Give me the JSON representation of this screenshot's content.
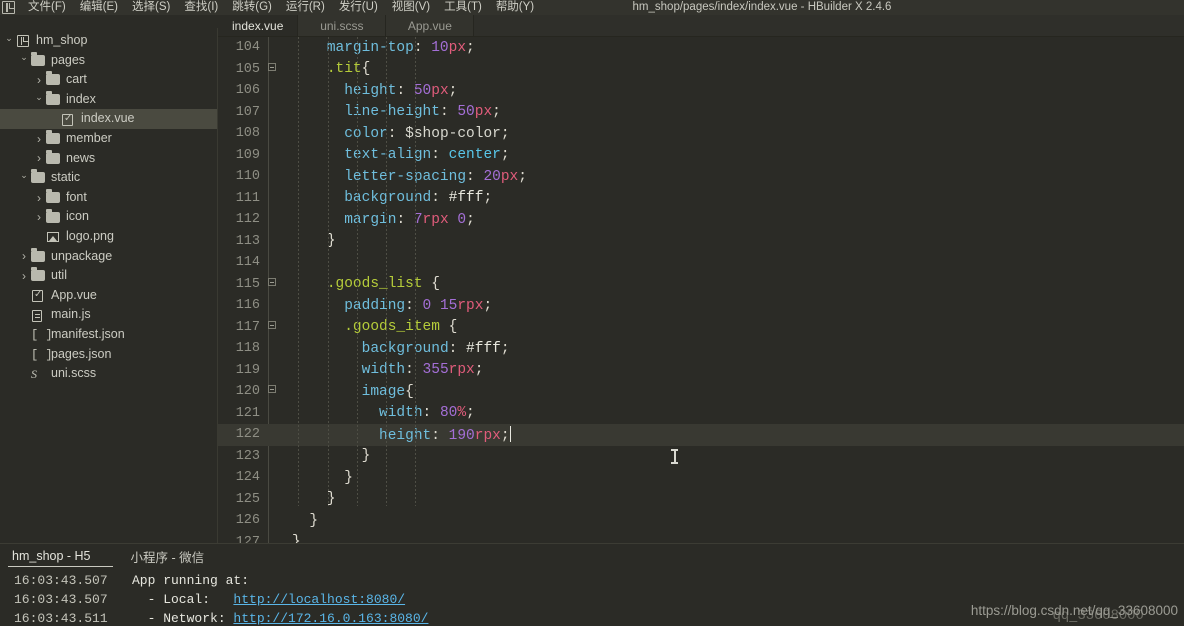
{
  "window": {
    "title": "hm_shop/pages/index/index.vue - HBuilder X 2.4.6",
    "logo_icon": "hbuilder-logo-icon"
  },
  "menubar": {
    "items": [
      {
        "label": "文件(F)",
        "name": "menu-file"
      },
      {
        "label": "编辑(E)",
        "name": "menu-edit"
      },
      {
        "label": "选择(S)",
        "name": "menu-select"
      },
      {
        "label": "查找(I)",
        "name": "menu-find"
      },
      {
        "label": "跳转(G)",
        "name": "menu-goto"
      },
      {
        "label": "运行(R)",
        "name": "menu-run"
      },
      {
        "label": "发行(U)",
        "name": "menu-publish"
      },
      {
        "label": "视图(V)",
        "name": "menu-view"
      },
      {
        "label": "工具(T)",
        "name": "menu-tools"
      },
      {
        "label": "帮助(Y)",
        "name": "menu-help"
      }
    ]
  },
  "tabs": [
    {
      "label": "index.vue",
      "active": true
    },
    {
      "label": "uni.scss",
      "active": false
    },
    {
      "label": "App.vue",
      "active": false
    }
  ],
  "sidebar": {
    "items": [
      {
        "label": "hm_shop",
        "depth": 0,
        "arrow": "down",
        "icon": "project-icon",
        "selected": false
      },
      {
        "label": "pages",
        "depth": 1,
        "arrow": "down",
        "icon": "folder-icon",
        "selected": false
      },
      {
        "label": "cart",
        "depth": 2,
        "arrow": "right",
        "icon": "folder-icon",
        "selected": false
      },
      {
        "label": "index",
        "depth": 2,
        "arrow": "down",
        "icon": "folder-icon",
        "selected": false
      },
      {
        "label": "index.vue",
        "depth": 3,
        "arrow": "none",
        "icon": "vue-file-icon",
        "selected": true
      },
      {
        "label": "member",
        "depth": 2,
        "arrow": "right",
        "icon": "folder-icon",
        "selected": false
      },
      {
        "label": "news",
        "depth": 2,
        "arrow": "right",
        "icon": "folder-icon",
        "selected": false
      },
      {
        "label": "static",
        "depth": 1,
        "arrow": "down",
        "icon": "folder-icon",
        "selected": false
      },
      {
        "label": "font",
        "depth": 2,
        "arrow": "right",
        "icon": "folder-icon",
        "selected": false
      },
      {
        "label": "icon",
        "depth": 2,
        "arrow": "right",
        "icon": "folder-icon",
        "selected": false
      },
      {
        "label": "logo.png",
        "depth": 2,
        "arrow": "none",
        "icon": "image-file-icon",
        "selected": false
      },
      {
        "label": "unpackage",
        "depth": 1,
        "arrow": "right",
        "icon": "folder-icon",
        "selected": false
      },
      {
        "label": "util",
        "depth": 1,
        "arrow": "right",
        "icon": "folder-icon",
        "selected": false
      },
      {
        "label": "App.vue",
        "depth": 1,
        "arrow": "none",
        "icon": "vue-file-icon",
        "selected": false
      },
      {
        "label": "main.js",
        "depth": 1,
        "arrow": "none",
        "icon": "js-file-icon",
        "selected": false
      },
      {
        "label": "manifest.json",
        "depth": 1,
        "arrow": "none",
        "icon": "json-file-icon",
        "selected": false
      },
      {
        "label": "pages.json",
        "depth": 1,
        "arrow": "none",
        "icon": "json-file-icon",
        "selected": false
      },
      {
        "label": "uni.scss",
        "depth": 1,
        "arrow": "none",
        "icon": "scss-file-icon",
        "selected": false
      }
    ]
  },
  "editor": {
    "first_line": 104,
    "current_line": 122,
    "lines": [
      {
        "n": 104,
        "fold": false,
        "tokens": [
          {
            "t": "\t\t",
            "c": "punc"
          },
          {
            "t": "margin-top",
            "c": "prop"
          },
          {
            "t": ": ",
            "c": "punc"
          },
          {
            "t": "10",
            "c": "num"
          },
          {
            "t": "px",
            "c": "unit"
          },
          {
            "t": ";",
            "c": "punc"
          }
        ]
      },
      {
        "n": 105,
        "fold": true,
        "tokens": [
          {
            "t": "\t\t",
            "c": "punc"
          },
          {
            "t": ".tit",
            "c": "sel"
          },
          {
            "t": "{",
            "c": "punc"
          }
        ]
      },
      {
        "n": 106,
        "fold": false,
        "tokens": [
          {
            "t": "\t\t\t",
            "c": "punc"
          },
          {
            "t": "height",
            "c": "prop"
          },
          {
            "t": ": ",
            "c": "punc"
          },
          {
            "t": "50",
            "c": "num"
          },
          {
            "t": "px",
            "c": "unit"
          },
          {
            "t": ";",
            "c": "punc"
          }
        ]
      },
      {
        "n": 107,
        "fold": false,
        "tokens": [
          {
            "t": "\t\t\t",
            "c": "punc"
          },
          {
            "t": "line-height",
            "c": "prop"
          },
          {
            "t": ": ",
            "c": "punc"
          },
          {
            "t": "50",
            "c": "num"
          },
          {
            "t": "px",
            "c": "unit"
          },
          {
            "t": ";",
            "c": "punc"
          }
        ]
      },
      {
        "n": 108,
        "fold": false,
        "tokens": [
          {
            "t": "\t\t\t",
            "c": "punc"
          },
          {
            "t": "color",
            "c": "prop"
          },
          {
            "t": ": ",
            "c": "punc"
          },
          {
            "t": "$shop-color",
            "c": "var"
          },
          {
            "t": ";",
            "c": "punc"
          }
        ]
      },
      {
        "n": 109,
        "fold": false,
        "tokens": [
          {
            "t": "\t\t\t",
            "c": "punc"
          },
          {
            "t": "text-align",
            "c": "prop"
          },
          {
            "t": ": ",
            "c": "punc"
          },
          {
            "t": "center",
            "c": "val"
          },
          {
            "t": ";",
            "c": "punc"
          }
        ]
      },
      {
        "n": 110,
        "fold": false,
        "tokens": [
          {
            "t": "\t\t\t",
            "c": "punc"
          },
          {
            "t": "letter-spacing",
            "c": "prop"
          },
          {
            "t": ": ",
            "c": "punc"
          },
          {
            "t": "20",
            "c": "num"
          },
          {
            "t": "px",
            "c": "unit"
          },
          {
            "t": ";",
            "c": "punc"
          }
        ]
      },
      {
        "n": 111,
        "fold": false,
        "tokens": [
          {
            "t": "\t\t\t",
            "c": "punc"
          },
          {
            "t": "background",
            "c": "prop"
          },
          {
            "t": ": ",
            "c": "punc"
          },
          {
            "t": "#fff",
            "c": "hex"
          },
          {
            "t": ";",
            "c": "punc"
          }
        ]
      },
      {
        "n": 112,
        "fold": false,
        "tokens": [
          {
            "t": "\t\t\t",
            "c": "punc"
          },
          {
            "t": "margin",
            "c": "prop"
          },
          {
            "t": ": ",
            "c": "punc"
          },
          {
            "t": "7",
            "c": "num"
          },
          {
            "t": "rpx",
            "c": "unit"
          },
          {
            "t": " ",
            "c": "punc"
          },
          {
            "t": "0",
            "c": "num"
          },
          {
            "t": ";",
            "c": "punc"
          }
        ]
      },
      {
        "n": 113,
        "fold": false,
        "tokens": [
          {
            "t": "\t\t",
            "c": "punc"
          },
          {
            "t": "}",
            "c": "punc"
          }
        ]
      },
      {
        "n": 114,
        "fold": false,
        "tokens": []
      },
      {
        "n": 115,
        "fold": true,
        "tokens": [
          {
            "t": "\t\t",
            "c": "punc"
          },
          {
            "t": ".goods_list",
            "c": "sel"
          },
          {
            "t": " {",
            "c": "punc"
          }
        ]
      },
      {
        "n": 116,
        "fold": false,
        "tokens": [
          {
            "t": "\t\t\t",
            "c": "punc"
          },
          {
            "t": "padding",
            "c": "prop"
          },
          {
            "t": ": ",
            "c": "punc"
          },
          {
            "t": "0",
            "c": "num"
          },
          {
            "t": " ",
            "c": "punc"
          },
          {
            "t": "15",
            "c": "num"
          },
          {
            "t": "rpx",
            "c": "unit"
          },
          {
            "t": ";",
            "c": "punc"
          }
        ]
      },
      {
        "n": 117,
        "fold": true,
        "tokens": [
          {
            "t": "\t\t\t",
            "c": "punc"
          },
          {
            "t": ".goods_item",
            "c": "sel"
          },
          {
            "t": " {",
            "c": "punc"
          }
        ]
      },
      {
        "n": 118,
        "fold": false,
        "tokens": [
          {
            "t": "\t\t\t\t",
            "c": "punc"
          },
          {
            "t": "background",
            "c": "prop"
          },
          {
            "t": ": ",
            "c": "punc"
          },
          {
            "t": "#fff",
            "c": "hex"
          },
          {
            "t": ";",
            "c": "punc"
          }
        ]
      },
      {
        "n": 119,
        "fold": false,
        "tokens": [
          {
            "t": "\t\t\t\t",
            "c": "punc"
          },
          {
            "t": "width",
            "c": "prop"
          },
          {
            "t": ": ",
            "c": "punc"
          },
          {
            "t": "355",
            "c": "num"
          },
          {
            "t": "rpx",
            "c": "unit"
          },
          {
            "t": ";",
            "c": "punc"
          }
        ]
      },
      {
        "n": 120,
        "fold": true,
        "tokens": [
          {
            "t": "\t\t\t\t",
            "c": "punc"
          },
          {
            "t": "image",
            "c": "prop"
          },
          {
            "t": "{",
            "c": "punc"
          }
        ]
      },
      {
        "n": 121,
        "fold": false,
        "tokens": [
          {
            "t": "\t\t\t\t\t",
            "c": "punc"
          },
          {
            "t": "width",
            "c": "prop"
          },
          {
            "t": ": ",
            "c": "punc"
          },
          {
            "t": "80",
            "c": "num"
          },
          {
            "t": "%",
            "c": "unit"
          },
          {
            "t": ";",
            "c": "punc"
          }
        ]
      },
      {
        "n": 122,
        "fold": false,
        "tokens": [
          {
            "t": "\t\t\t\t\t",
            "c": "punc"
          },
          {
            "t": "height",
            "c": "prop"
          },
          {
            "t": ": ",
            "c": "punc"
          },
          {
            "t": "190",
            "c": "num"
          },
          {
            "t": "rpx",
            "c": "unit"
          },
          {
            "t": ";",
            "c": "punc"
          }
        ],
        "caret": true
      },
      {
        "n": 123,
        "fold": false,
        "tokens": [
          {
            "t": "\t\t\t\t",
            "c": "punc"
          },
          {
            "t": "}",
            "c": "punc"
          }
        ]
      },
      {
        "n": 124,
        "fold": false,
        "tokens": [
          {
            "t": "\t\t\t",
            "c": "punc"
          },
          {
            "t": "}",
            "c": "punc"
          }
        ]
      },
      {
        "n": 125,
        "fold": false,
        "tokens": [
          {
            "t": "\t\t",
            "c": "punc"
          },
          {
            "t": "}",
            "c": "punc"
          }
        ]
      },
      {
        "n": 126,
        "fold": false,
        "tokens": [
          {
            "t": "\t",
            "c": "punc"
          },
          {
            "t": "}",
            "c": "punc"
          }
        ]
      },
      {
        "n": 127,
        "fold": false,
        "tokens": [
          {
            "t": "}",
            "c": "punc"
          }
        ]
      }
    ]
  },
  "console": {
    "tabs": [
      {
        "label": "hm_shop - H5",
        "active": true
      },
      {
        "label": "小程序 - 微信",
        "active": false
      }
    ],
    "logs": [
      {
        "time": "16:03:43.507",
        "text": "App running at:",
        "link": ""
      },
      {
        "time": "16:03:43.507",
        "text": "  - Local:   ",
        "link": "http://localhost:8080/"
      },
      {
        "time": "16:03:43.511",
        "text": "  - Network: ",
        "link": "http://172.16.0.163:8080/"
      }
    ]
  },
  "watermark": {
    "url": "https://blog.csdn.net/qq_33608000",
    "stamp": "qq_33608000"
  },
  "colors": {
    "background": "#2b2b26",
    "menubar": "#33332d",
    "selection": "#4a4a40",
    "selector": "#b5cc3a",
    "property": "#6fbedd",
    "number": "#a46fd6",
    "unit": "#e05c7b",
    "value": "#59c7ea",
    "link": "#5ab6e8"
  }
}
